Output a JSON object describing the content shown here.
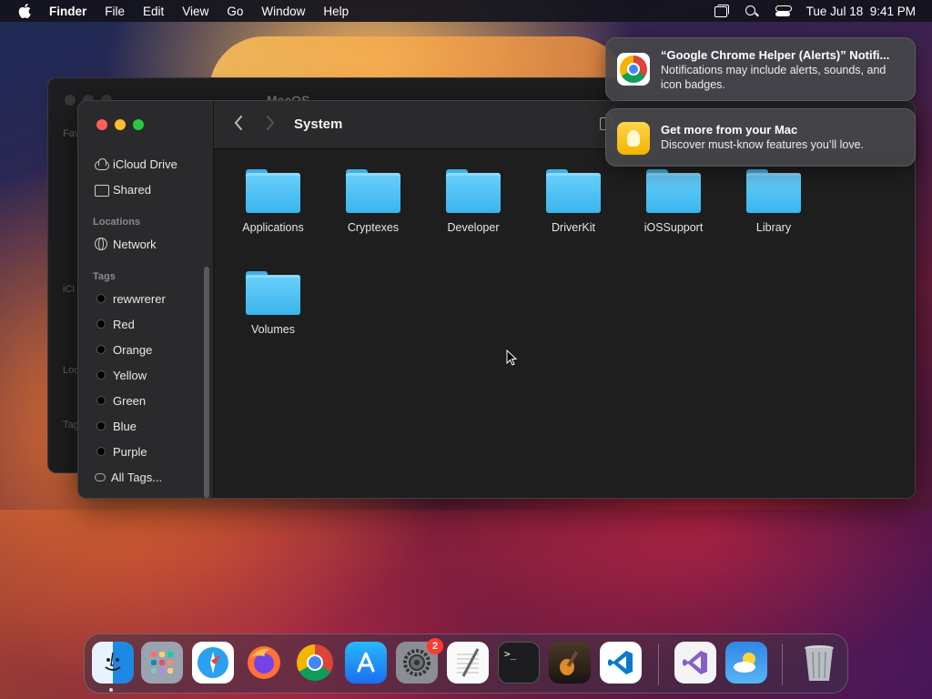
{
  "menubar": {
    "apple_icon": "apple-icon",
    "app_name": "Finder",
    "menus": [
      "File",
      "Edit",
      "View",
      "Go",
      "Window",
      "Help"
    ],
    "datetime": "Tue Jul 18  9:41 PM"
  },
  "back_window": {
    "title": "MacOS",
    "labels": [
      "Fav",
      "iCl",
      "Loc",
      "Tag"
    ]
  },
  "finder": {
    "title": "System",
    "sidebar": {
      "top_items": [
        {
          "label": "iCloud Drive",
          "icon": "cloud-icon"
        },
        {
          "label": "Shared",
          "icon": "shared-folder-icon"
        }
      ],
      "locations_header": "Locations",
      "locations": [
        {
          "label": "Network",
          "icon": "globe-icon"
        }
      ],
      "tags_header": "Tags",
      "tags": [
        "rewwrerer",
        "Red",
        "Orange",
        "Yellow",
        "Green",
        "Blue",
        "Purple"
      ],
      "all_tags": "All Tags..."
    },
    "folders": [
      "Applications",
      "Cryptexes",
      "Developer",
      "DriverKit",
      "iOSSupport",
      "Library",
      "Volumes"
    ]
  },
  "notifications": [
    {
      "app": "Google Chrome",
      "icon": "chrome-icon",
      "title": "“Google Chrome Helper (Alerts)” Notifi...",
      "body": "Notifications may include alerts, sounds, and icon badges."
    },
    {
      "app": "Tips",
      "icon": "lightbulb-icon",
      "title": "Get more from your Mac",
      "body": "Discover must-know features you’ll love."
    }
  ],
  "dock": {
    "apps": [
      {
        "name": "Finder",
        "icon": "finder-icon",
        "running": true
      },
      {
        "name": "Launchpad",
        "icon": "launchpad-icon"
      },
      {
        "name": "Safari",
        "icon": "safari-icon"
      },
      {
        "name": "Firefox",
        "icon": "firefox-icon"
      },
      {
        "name": "Google Chrome",
        "icon": "chrome-icon"
      },
      {
        "name": "App Store",
        "icon": "app-store-icon"
      },
      {
        "name": "System Settings",
        "icon": "settings-gear-icon",
        "badge": "2"
      },
      {
        "name": "TextEdit",
        "icon": "textedit-icon"
      },
      {
        "name": "Terminal",
        "icon": "terminal-icon"
      },
      {
        "name": "GarageBand",
        "icon": "garageband-icon"
      },
      {
        "name": "Visual Studio Code",
        "icon": "vscode-icon"
      },
      {
        "name": "Visual Studio",
        "icon": "visual-studio-icon"
      },
      {
        "name": "Weather",
        "icon": "weather-icon"
      },
      {
        "name": "Trash",
        "icon": "trash-icon"
      }
    ]
  },
  "colors": {
    "folder_blue": "#3ab4ee",
    "close_red": "#ff5f57",
    "minimize_yellow": "#febc2e",
    "zoom_green": "#28c840",
    "badge_red": "#ff3b30"
  }
}
